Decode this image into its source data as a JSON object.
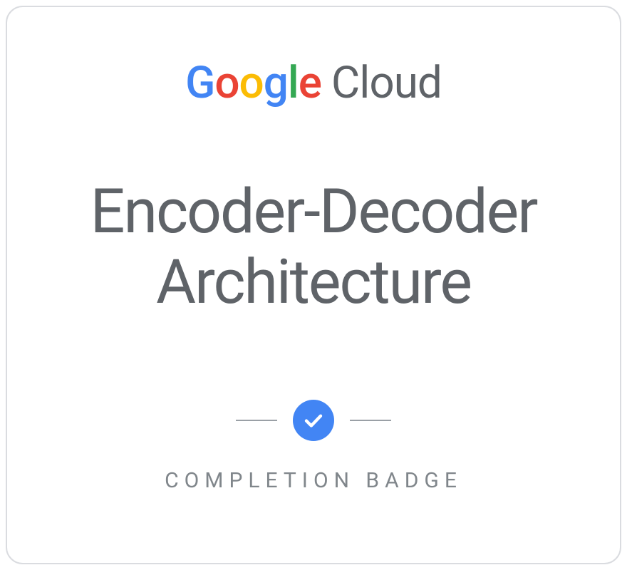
{
  "brand": {
    "name": "Google",
    "product": "Cloud"
  },
  "badge": {
    "title_line1": "Encoder-Decoder",
    "title_line2": "Architecture",
    "footer": "COMPLETION BADGE"
  },
  "colors": {
    "google_blue": "#4285F4",
    "google_red": "#EA4335",
    "google_yellow": "#FBBC05",
    "google_green": "#34A853",
    "text_gray": "#5f6368",
    "border_gray": "#dadce0"
  }
}
